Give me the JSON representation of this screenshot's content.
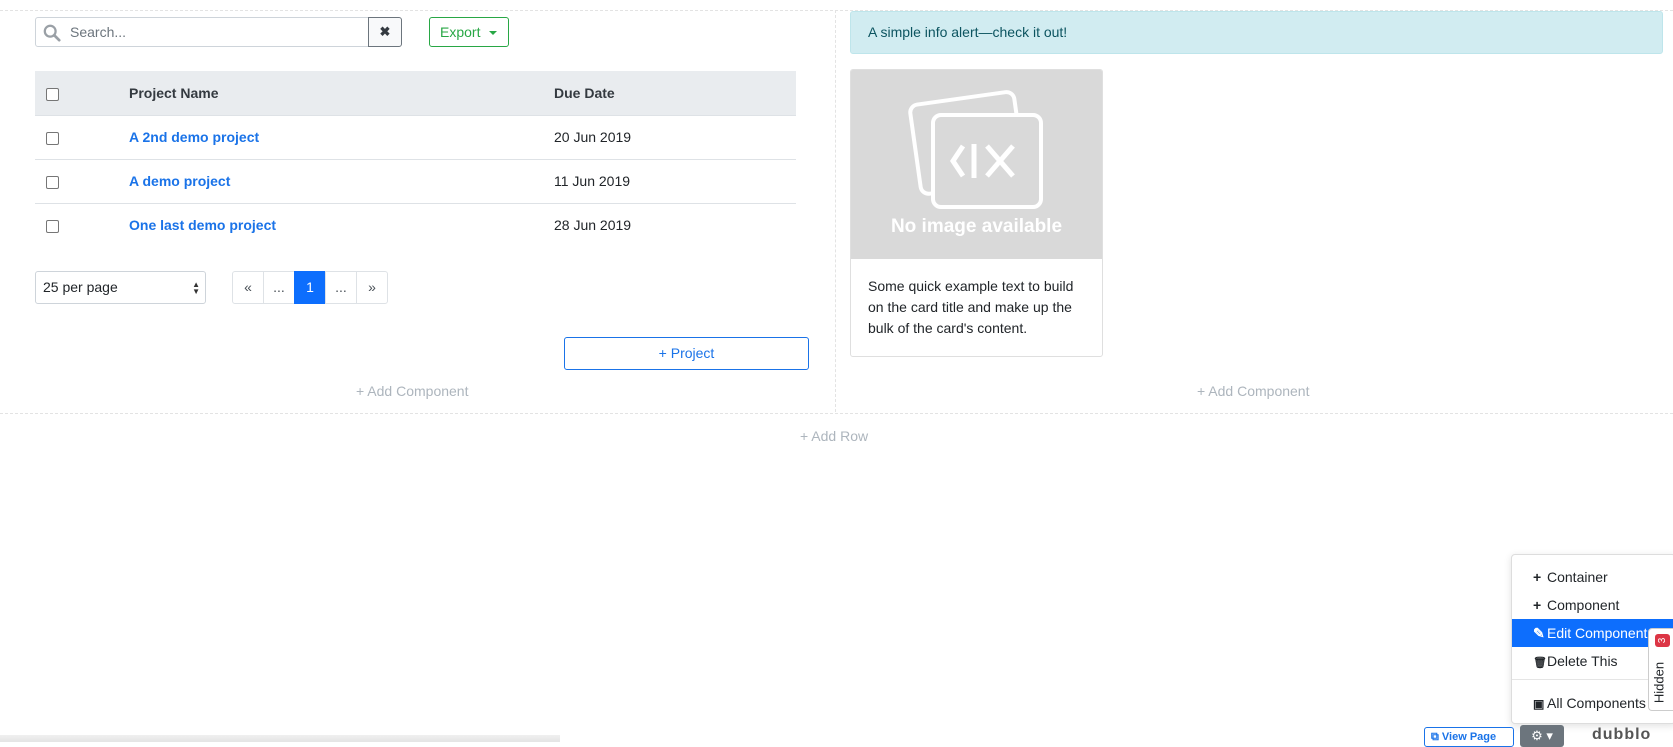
{
  "search": {
    "placeholder": "Search...",
    "clear_symbol": "✖"
  },
  "toolbar": {
    "export_label": "Export"
  },
  "table": {
    "columns": [
      "Project Name",
      "Due Date"
    ],
    "rows": [
      {
        "name": "A 2nd demo project",
        "due": "20 Jun 2019"
      },
      {
        "name": "A demo project",
        "due": "11 Jun 2019"
      },
      {
        "name": "One last demo project",
        "due": "28 Jun 2019"
      }
    ]
  },
  "pagination": {
    "per_page": "25 per page",
    "pages": [
      "«",
      "...",
      "1",
      "...",
      "»"
    ],
    "active_page": "1"
  },
  "buttons": {
    "add_project": "+ Project"
  },
  "builder": {
    "add_component": "+ Add Component",
    "add_row": "+ Add Row"
  },
  "alert": {
    "text": "A simple info alert—check it out!"
  },
  "card": {
    "image_text": "No image available",
    "body": "Some quick example text to build on the card title and make up the bulk of the card's content."
  },
  "context_menu": {
    "items": [
      {
        "icon": "+",
        "label": "Container"
      },
      {
        "icon": "+",
        "label": "Component"
      },
      {
        "icon": "✎",
        "label": "Edit Component"
      },
      {
        "icon": "🗑",
        "label": "Delete This"
      },
      {
        "icon": "▣",
        "label": "All Components"
      }
    ],
    "highlight_color": "#0d6efd"
  },
  "hidden_tab": {
    "label": "Hidden",
    "count": "3"
  },
  "bottom_bar": {
    "view_page": "View Page",
    "brand": "dubblo"
  },
  "colors": {
    "link": "#1a73e8",
    "export": "#28a745",
    "alert_bg": "#d1ecf1"
  }
}
